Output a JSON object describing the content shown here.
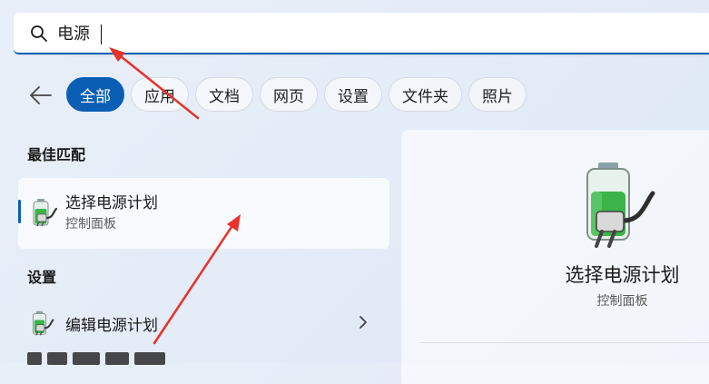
{
  "search": {
    "value": "电源"
  },
  "filters": [
    {
      "label": "全部",
      "active": true
    },
    {
      "label": "应用",
      "active": false
    },
    {
      "label": "文档",
      "active": false
    },
    {
      "label": "网页",
      "active": false
    },
    {
      "label": "设置",
      "active": false
    },
    {
      "label": "文件夹",
      "active": false
    },
    {
      "label": "照片",
      "active": false
    }
  ],
  "best_match": {
    "section_title": "最佳匹配",
    "title": "选择电源计划",
    "subtitle": "控制面板",
    "icon": "battery-plug-icon"
  },
  "settings": {
    "section_title": "设置",
    "items": [
      {
        "title": "编辑电源计划",
        "icon": "battery-plug-icon"
      }
    ]
  },
  "detail": {
    "title": "选择电源计划",
    "subtitle": "控制面板",
    "icon": "battery-plug-icon"
  },
  "colors": {
    "accent": "#0a5fb4",
    "annotation_arrow": "#e8322b",
    "battery_green": "#3cb44a"
  }
}
